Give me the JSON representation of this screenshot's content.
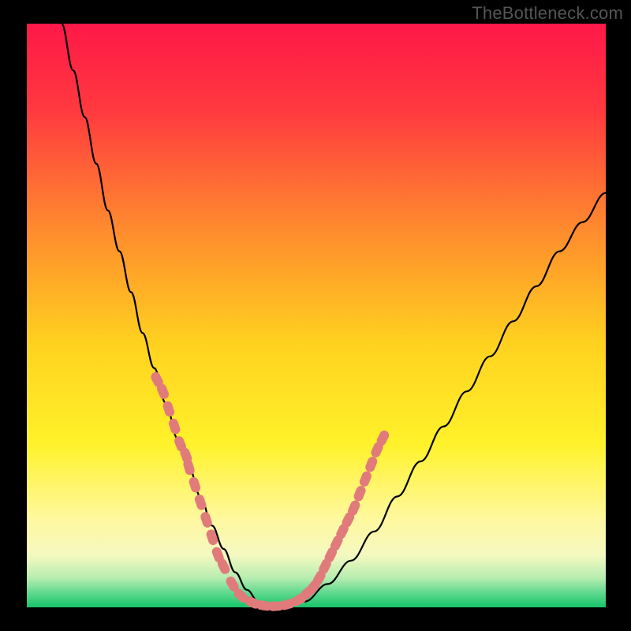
{
  "watermark": "TheBottleneck.com",
  "chart_data": {
    "type": "line",
    "title": "",
    "xlabel": "",
    "ylabel": "",
    "xlim": [
      0,
      100
    ],
    "ylim": [
      0,
      100
    ],
    "background_gradient_stops": [
      {
        "offset": 0.0,
        "color": "#ff1848"
      },
      {
        "offset": 0.15,
        "color": "#ff3a3f"
      },
      {
        "offset": 0.35,
        "color": "#ff8a2e"
      },
      {
        "offset": 0.55,
        "color": "#ffd21f"
      },
      {
        "offset": 0.72,
        "color": "#fff22a"
      },
      {
        "offset": 0.85,
        "color": "#fff8a0"
      },
      {
        "offset": 0.91,
        "color": "#f5f9c0"
      },
      {
        "offset": 0.95,
        "color": "#b6edb0"
      },
      {
        "offset": 0.975,
        "color": "#5fd98e"
      },
      {
        "offset": 1.0,
        "color": "#17c46a"
      }
    ],
    "series": [
      {
        "name": "bottleneck-curve",
        "x": [
          6,
          8,
          10,
          12,
          14,
          16,
          18,
          20,
          22,
          24,
          26,
          28,
          30,
          32,
          34,
          36,
          38,
          40,
          44,
          48,
          52,
          56,
          60,
          64,
          68,
          72,
          76,
          80,
          84,
          88,
          92,
          96,
          100
        ],
        "y": [
          100,
          92,
          84,
          76,
          68,
          61,
          54,
          47,
          41,
          35,
          29,
          24,
          19,
          14,
          10,
          6,
          3,
          1,
          0,
          1,
          4,
          8,
          13,
          19,
          25,
          31,
          37,
          43,
          49,
          55,
          61,
          66,
          71
        ]
      }
    ],
    "highlight_points": {
      "name": "highlighted-range",
      "color": "#e17b7b",
      "points": [
        {
          "x": 22.5,
          "y": 39
        },
        {
          "x": 23.5,
          "y": 37
        },
        {
          "x": 24.5,
          "y": 34
        },
        {
          "x": 25.5,
          "y": 31
        },
        {
          "x": 26.5,
          "y": 28
        },
        {
          "x": 27.5,
          "y": 26
        },
        {
          "x": 28.0,
          "y": 24
        },
        {
          "x": 29.0,
          "y": 21
        },
        {
          "x": 30.0,
          "y": 18
        },
        {
          "x": 31.0,
          "y": 15
        },
        {
          "x": 32.0,
          "y": 12
        },
        {
          "x": 33.0,
          "y": 9
        },
        {
          "x": 34.0,
          "y": 7
        },
        {
          "x": 35.5,
          "y": 4
        },
        {
          "x": 37.0,
          "y": 2
        },
        {
          "x": 39.0,
          "y": 0.8
        },
        {
          "x": 41.0,
          "y": 0.3
        },
        {
          "x": 43.0,
          "y": 0.2
        },
        {
          "x": 45.0,
          "y": 0.5
        },
        {
          "x": 47.0,
          "y": 1.3
        },
        {
          "x": 48.5,
          "y": 2.5
        },
        {
          "x": 49.5,
          "y": 3.5
        },
        {
          "x": 50.5,
          "y": 5
        },
        {
          "x": 51.5,
          "y": 7
        },
        {
          "x": 52.5,
          "y": 9
        },
        {
          "x": 53.5,
          "y": 11
        },
        {
          "x": 54.5,
          "y": 13
        },
        {
          "x": 55.5,
          "y": 15
        },
        {
          "x": 56.5,
          "y": 17
        },
        {
          "x": 57.5,
          "y": 19.5
        },
        {
          "x": 58.5,
          "y": 22
        },
        {
          "x": 59.5,
          "y": 24.5
        },
        {
          "x": 60.5,
          "y": 27
        },
        {
          "x": 61.5,
          "y": 29
        }
      ]
    }
  }
}
